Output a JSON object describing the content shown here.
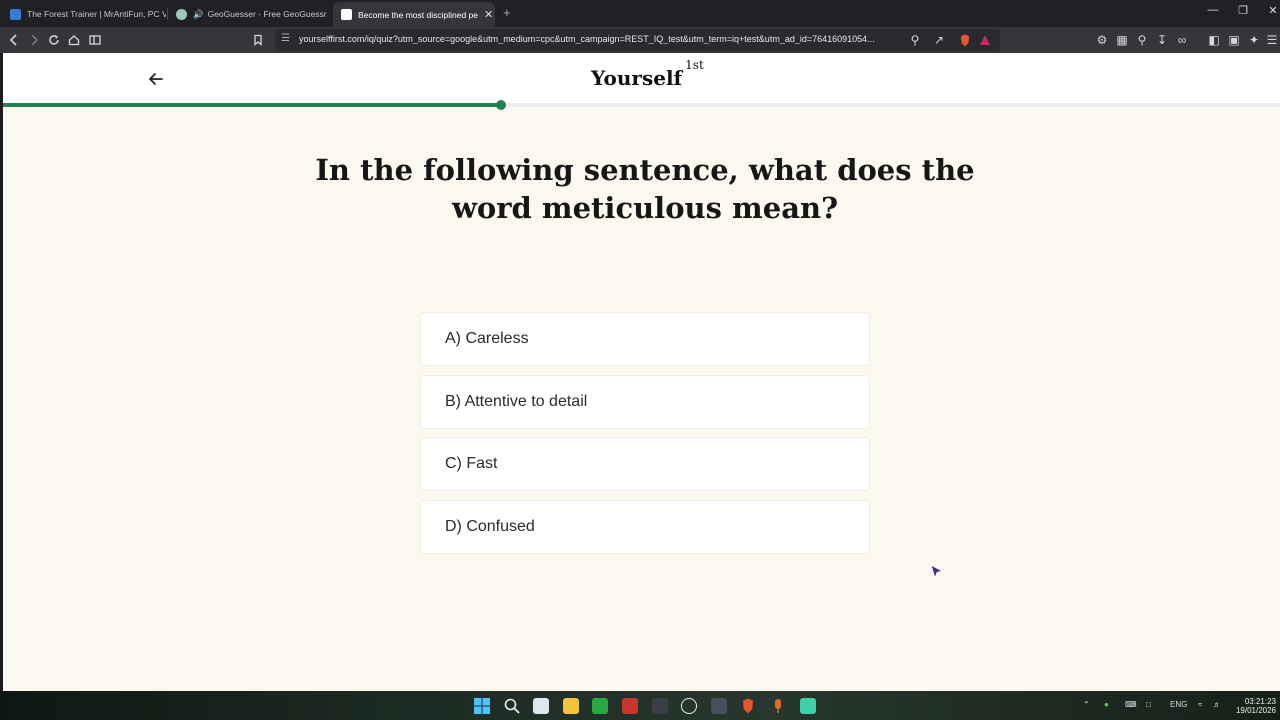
{
  "browser": {
    "tabs": [
      {
        "title": "The Forest Trainer | MrAntiFun, PC Vi",
        "active": false
      },
      {
        "title": "GeoGuesser - Free GeoGuessr Al",
        "active": false
      },
      {
        "title": "Become the most disciplined pe",
        "active": true
      }
    ],
    "url": "yourselffirst.com/iq/quiz?utm_source=google&utm_medium=cpc&utm_campaign=REST_IQ_test&utm_term=iq+test&utm_ad_id=76416091054..."
  },
  "header": {
    "brand": "Yourself",
    "brand_sup": "1st"
  },
  "progress": {
    "fraction": 0.39
  },
  "question": {
    "text": "In the following sentence, what does the word meticulous mean?"
  },
  "options": [
    {
      "label": "A) Careless"
    },
    {
      "label": "B) Attentive to detail"
    },
    {
      "label": "C) Fast"
    },
    {
      "label": "D) Confused"
    }
  ],
  "taskbar": {
    "language": "ENG",
    "time": "03:21:23",
    "date": "19/01/2026"
  },
  "colors": {
    "accent": "#23814f",
    "page_bg": "#fbf9ef"
  }
}
